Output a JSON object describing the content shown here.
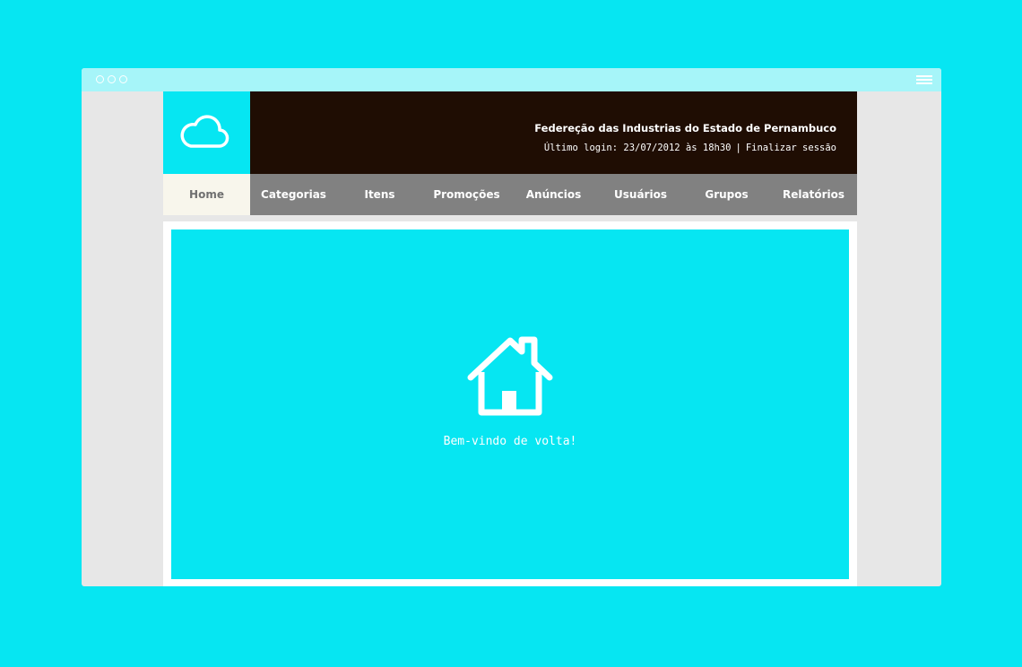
{
  "window": {
    "control_icons": [
      "circle-icon",
      "circle-icon",
      "circle-icon"
    ],
    "menu_icon": "hamburger-menu-icon"
  },
  "header": {
    "logo_icon": "cloud-icon",
    "organization": "Federeção das Industrias do Estado de Pernambuco",
    "last_login": "Último login: 23/07/2012 às 18h30",
    "separator": "|",
    "logout_label": "Finalizar sessão"
  },
  "nav": {
    "active_index": 0,
    "items": [
      {
        "label": "Home"
      },
      {
        "label": "Categorias"
      },
      {
        "label": "Itens"
      },
      {
        "label": "Promoções"
      },
      {
        "label": "Anúncios"
      },
      {
        "label": "Usuários"
      },
      {
        "label": "Grupos"
      },
      {
        "label": "Relatórios"
      }
    ]
  },
  "main": {
    "icon": "house-icon",
    "welcome": "Bem-vindo de volta!"
  },
  "colors": {
    "background": "#06e6f2",
    "header": "#1f0d03",
    "nav": "#818181",
    "nav_active": "#f8f6ec",
    "window": "#e7e7e7",
    "titlebar": "#a6f5f9"
  }
}
